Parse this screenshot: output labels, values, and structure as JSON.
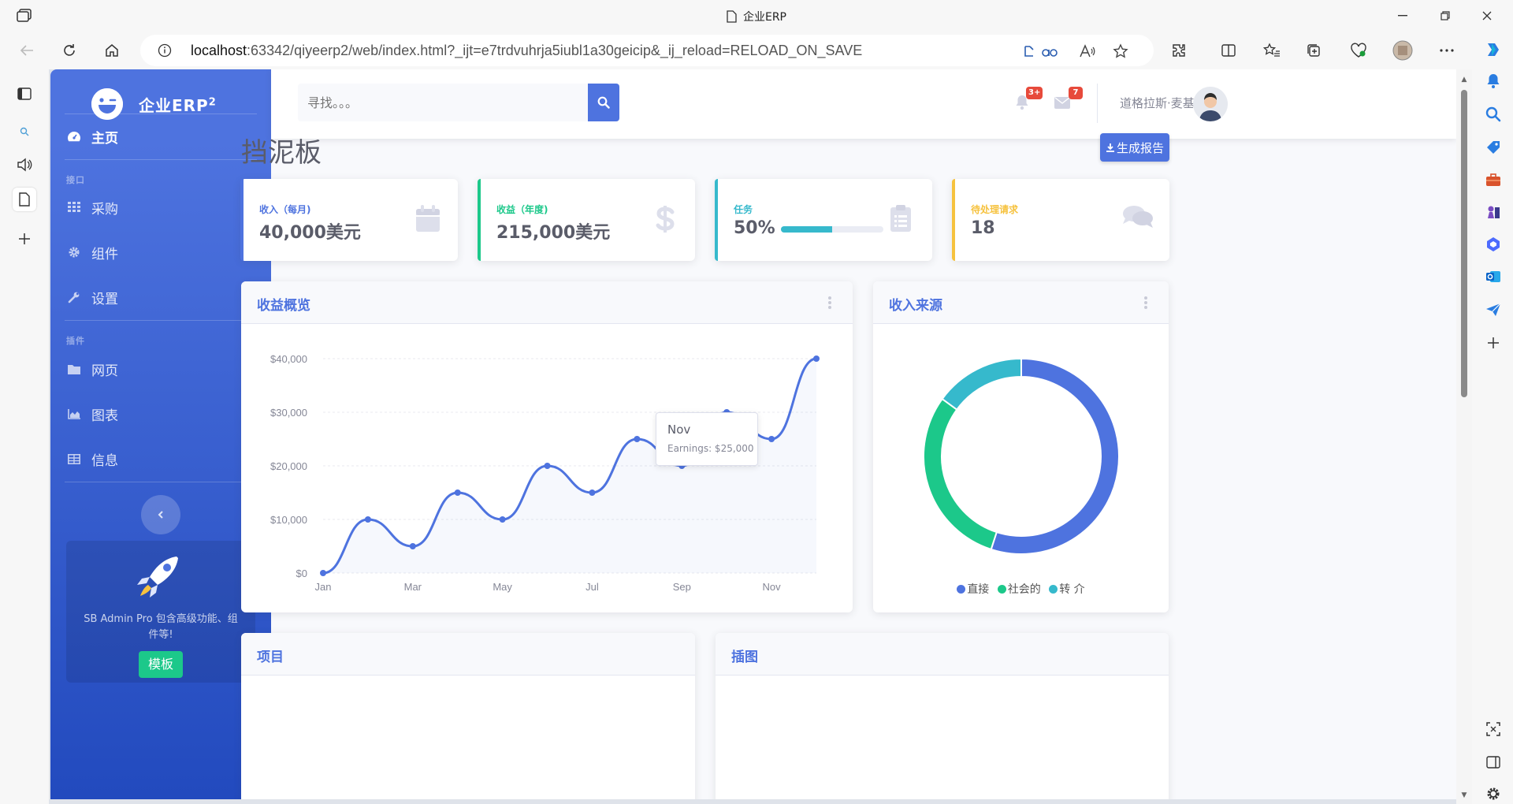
{
  "browser": {
    "tab_title": "企业ERP",
    "url_host": "localhost",
    "url_rest": ":63342/qiyeerp2/web/index.html?_ijt=e7trdvuhrja5iubl1a30geicip&_ij_reload=RELOAD_ON_SAVE"
  },
  "brand": {
    "name": "企业ERP",
    "sup": "2"
  },
  "sidebar": {
    "home": "主页",
    "heading_interface": "接口",
    "heading_plugins": "插件",
    "items": [
      {
        "label": "采购"
      },
      {
        "label": "组件"
      },
      {
        "label": "设置"
      },
      {
        "label": "网页"
      },
      {
        "label": "图表"
      },
      {
        "label": "信息"
      }
    ],
    "promo_text": "SB Admin Pro 包含高级功能、组件等!",
    "promo_button": "模板"
  },
  "topbar": {
    "search_placeholder": "寻找。。。",
    "alerts_badge": "3+",
    "messages_badge": "7",
    "user_name": "道格拉斯·麦基"
  },
  "page": {
    "title": "挡泥板",
    "report_button": "生成报告"
  },
  "stats": [
    {
      "label": "收入（每月)",
      "value": "40,000美元",
      "color": "#4e73df",
      "icon": "calendar-icon"
    },
    {
      "label": "收益（年度)",
      "value": "215,000美元",
      "color": "#1cc88a",
      "icon": "dollar-icon"
    },
    {
      "label": "任务",
      "value": "50%",
      "color": "#36b9cc",
      "icon": "clipboard-icon",
      "progress": 0.5
    },
    {
      "label": "待处理请求",
      "value": "18",
      "color": "#f6c23e",
      "icon": "comments-icon"
    }
  ],
  "panels": {
    "earnings_title": "收益概览",
    "revenue_title": "收入来源",
    "bottom_left_title": "项目",
    "bottom_right_title": "插图"
  },
  "tooltip": {
    "title": "Nov",
    "body": "Earnings: $25,000"
  },
  "chart_data": [
    {
      "type": "line",
      "title": "收益概览",
      "categories": [
        "Jan",
        "Feb",
        "Mar",
        "Apr",
        "May",
        "Jun",
        "Jul",
        "Aug",
        "Sep",
        "Oct",
        "Nov",
        "Dec"
      ],
      "x_tick_labels": [
        "Jan",
        "Mar",
        "May",
        "Jul",
        "Sep",
        "Nov"
      ],
      "y_tick_labels": [
        "$0",
        "$10,000",
        "$20,000",
        "$30,000",
        "$40,000"
      ],
      "series": [
        {
          "values": [
            0,
            10000,
            5000,
            15000,
            10000,
            20000,
            15000,
            25000,
            20000,
            30000,
            25000,
            40000
          ]
        }
      ],
      "ylim": [
        0,
        40000
      ],
      "grid": true,
      "color": "#4e73df"
    },
    {
      "type": "pie",
      "title": "收入来源",
      "labels": [
        "直接",
        "社会的",
        "转 介"
      ],
      "values": [
        55,
        30,
        15
      ],
      "colors": [
        "#4e73df",
        "#1cc88a",
        "#36b9cc"
      ],
      "legend": "bottom"
    }
  ]
}
